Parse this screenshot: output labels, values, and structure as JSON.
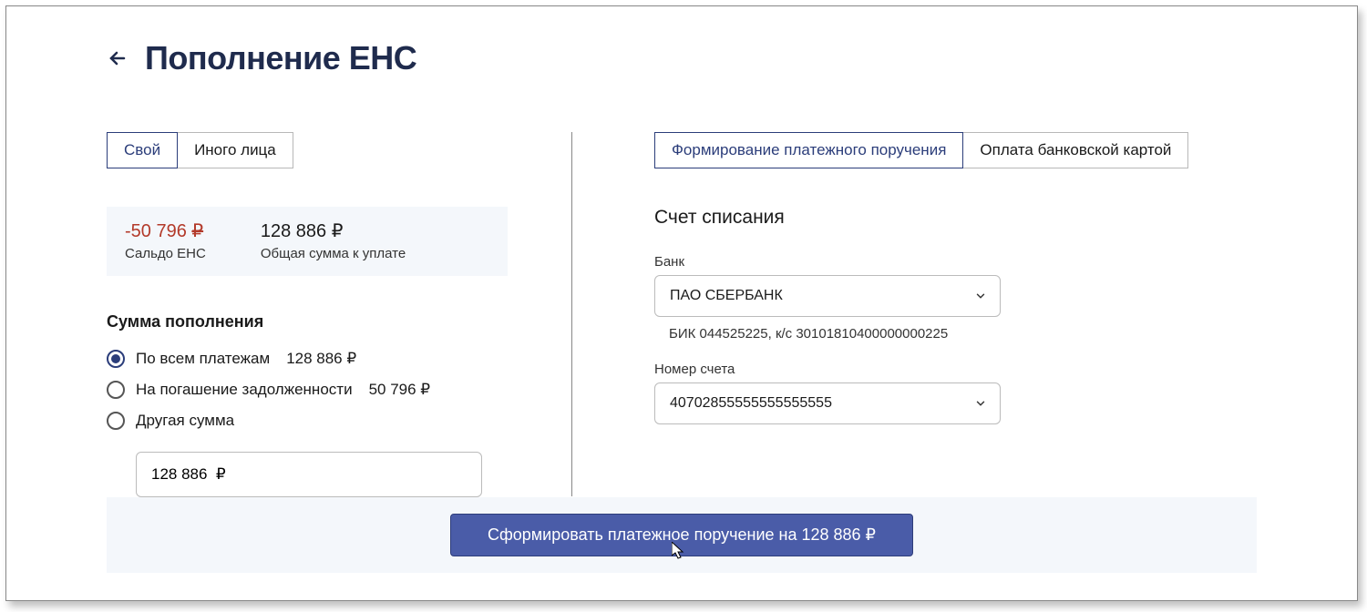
{
  "header": {
    "title": "Пополнение ЕНС"
  },
  "left": {
    "tabs": {
      "own": "Свой",
      "other": "Иного лица"
    },
    "balance": {
      "saldo_value": "-50 796 ",
      "saldo_ruble": "₽",
      "saldo_label": "Сальдо ЕНС",
      "total_value": "128 886 ₽",
      "total_label": "Общая сумма к уплате"
    },
    "amount_section_title": "Сумма пополнения",
    "radios": {
      "all_label": "По всем платежам",
      "all_value": "128 886 ₽",
      "debt_label": "На погашение задолженности",
      "debt_value": "50 796 ₽",
      "other_label": "Другая сумма"
    },
    "amount_input_value": "128 886  ₽"
  },
  "right": {
    "tabs": {
      "form": "Формирование платежного поручения",
      "card": "Оплата банковской картой"
    },
    "section_title": "Счет списания",
    "bank_label": "Банк",
    "bank_value": "ПАО СБЕРБАНК",
    "bank_helper": "БИК 044525225, к/с 30101810400000000225",
    "account_label": "Номер счета",
    "account_value": "40702855555555555555"
  },
  "footer": {
    "button_label": "Сформировать платежное поручение на 128 886 ₽"
  }
}
